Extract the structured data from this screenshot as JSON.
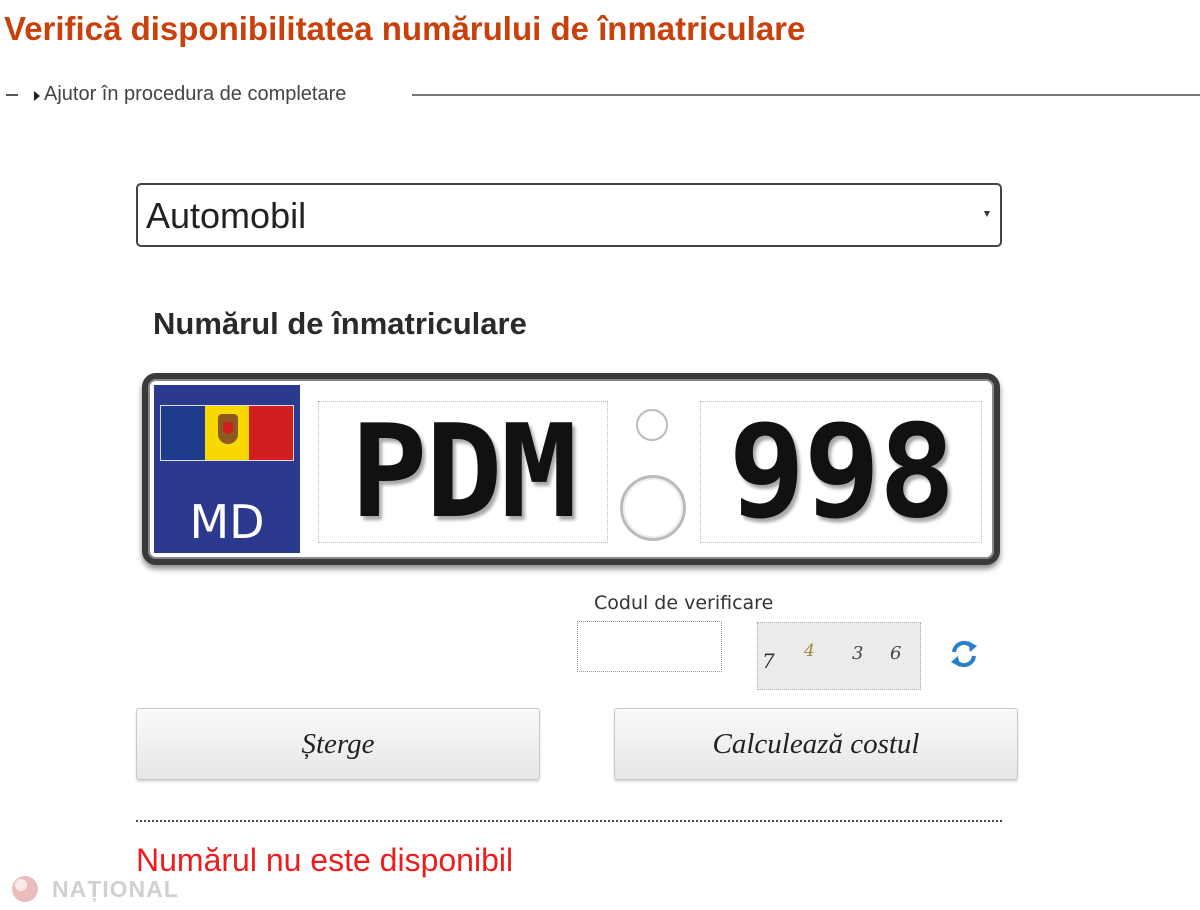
{
  "page": {
    "title": "Verifică disponibilitatea numărului de înmatriculare",
    "help_link": "Ajutor în procedura de completare"
  },
  "form": {
    "vehicle_type": "Automobil",
    "plate_heading": "Numărul de înmatriculare",
    "plate": {
      "country_code": "MD",
      "letters": "PDM",
      "digits": "998"
    },
    "captcha": {
      "label": "Codul de verificare",
      "input_value": "",
      "image_digits": [
        "7",
        "4",
        "3",
        "6"
      ]
    },
    "buttons": {
      "clear": "Șterge",
      "calculate": "Calculează costul"
    }
  },
  "result": {
    "message": "Numărul nu este disponibil",
    "color": "#ee1c1c"
  },
  "watermark": {
    "text": "NAȚIONAL"
  },
  "colors": {
    "title": "#c8400a",
    "euroband": "#2b3a8e",
    "refresh_icon": "#2a7ec8"
  },
  "icons": {
    "help": "triangle-right-icon",
    "select": "chevron-down-icon",
    "refresh": "refresh-icon"
  }
}
